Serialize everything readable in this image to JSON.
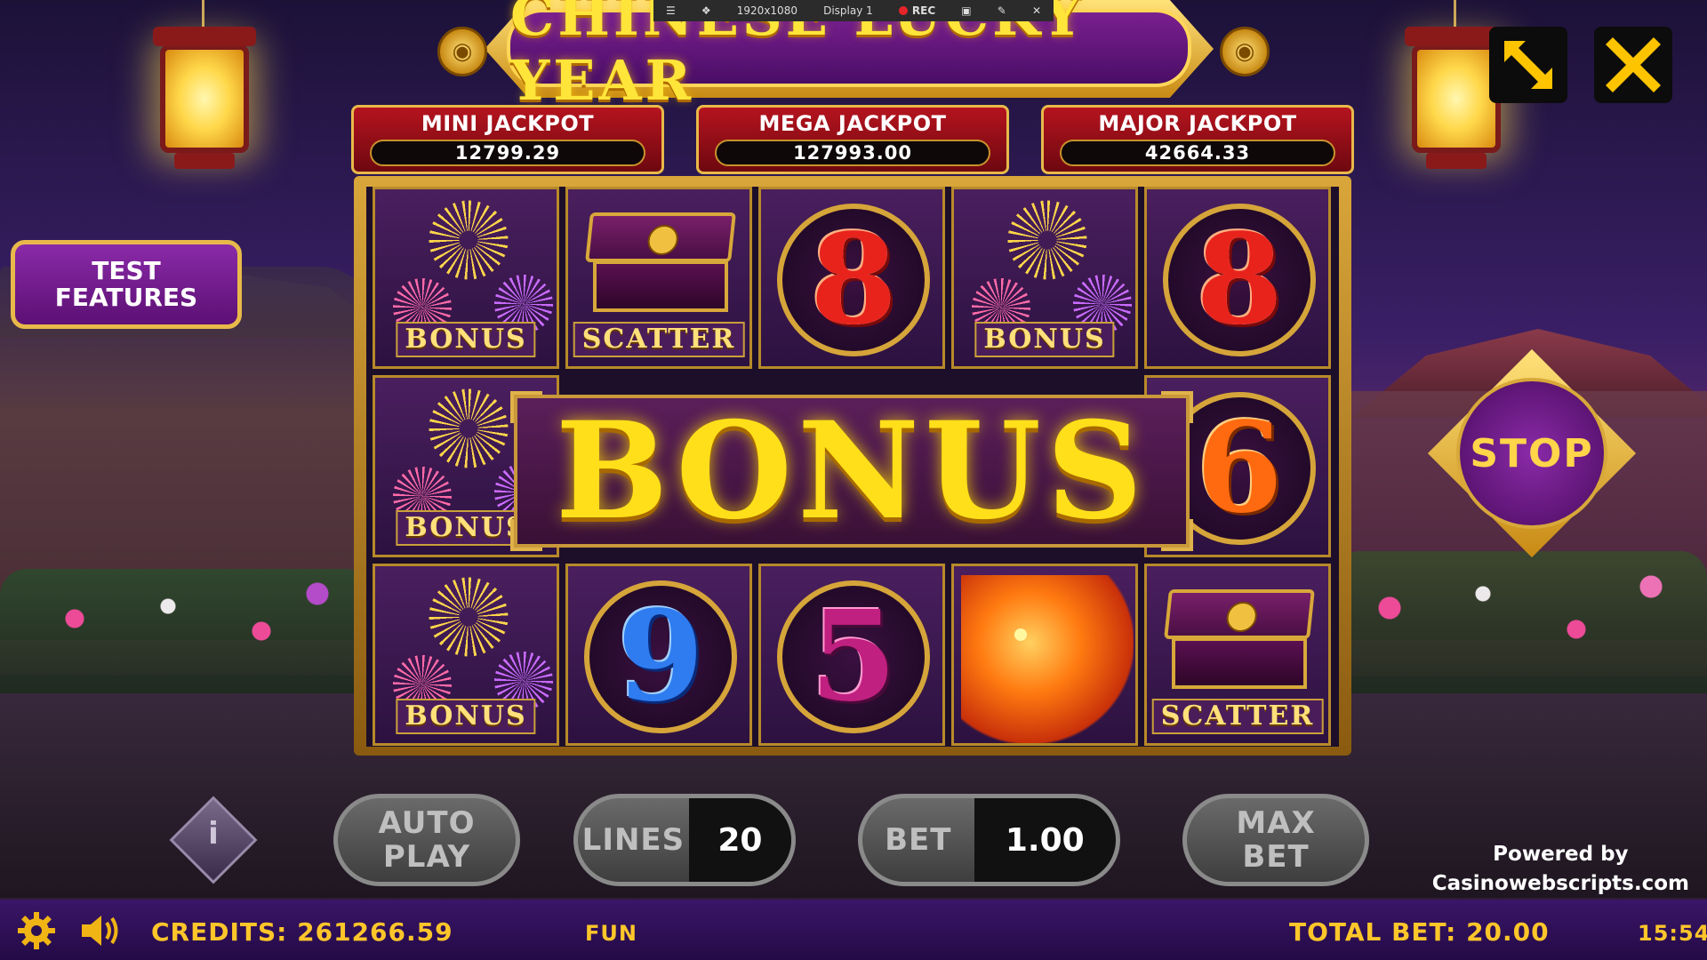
{
  "toolbar": {
    "resolution": "1920x1080",
    "display": "Display 1",
    "rec": "REC"
  },
  "title": "CHINESE LUCKY YEAR",
  "jackpots": [
    {
      "label": "MINI JACKPOT",
      "value": "12799.29"
    },
    {
      "label": "MEGA JACKPOT",
      "value": "127993.00"
    },
    {
      "label": "MAJOR JACKPOT",
      "value": "42664.33"
    }
  ],
  "reels": [
    [
      {
        "symbol": "bonus",
        "label": "BONUS"
      },
      {
        "symbol": "scatter",
        "label": "SCATTER"
      },
      {
        "symbol": "8",
        "label": "8"
      },
      {
        "symbol": "bonus",
        "label": "BONUS"
      },
      {
        "symbol": "8",
        "label": "8"
      }
    ],
    [
      {
        "symbol": "bonus",
        "label": "BONUS"
      },
      {
        "symbol": "6",
        "label": "6"
      }
    ],
    [
      {
        "symbol": "bonus",
        "label": "BONUS"
      },
      {
        "symbol": "9",
        "label": "9"
      },
      {
        "symbol": "5",
        "label": "5"
      },
      {
        "symbol": "dragon",
        "label": ""
      },
      {
        "symbol": "scatter",
        "label": "SCATTER"
      }
    ]
  ],
  "bonus_banner": "BONUS",
  "buttons": {
    "test_features_line1": "TEST",
    "test_features_line2": "FEATURES",
    "stop": "STOP",
    "auto_play_line1": "AUTO",
    "auto_play_line2": "PLAY",
    "lines_label": "LINES",
    "lines_value": "20",
    "bet_label": "BET",
    "bet_value": "1.00",
    "max_bet_line1": "MAX",
    "max_bet_line2": "BET",
    "info": "i"
  },
  "powered_by": {
    "line1": "Powered by",
    "line2": "Casinowebscripts.com"
  },
  "status": {
    "credits": "CREDITS: 261266.59",
    "mode": "FUN",
    "total_bet": "TOTAL BET: 20.00",
    "time": "15:54"
  },
  "icons": [
    "expand-icon",
    "close-icon",
    "gear-icon",
    "speaker-icon"
  ],
  "colors": {
    "accent": "#ffd54a",
    "panel_purple": "#5c1074",
    "jackpot_red": "#b5141e"
  }
}
